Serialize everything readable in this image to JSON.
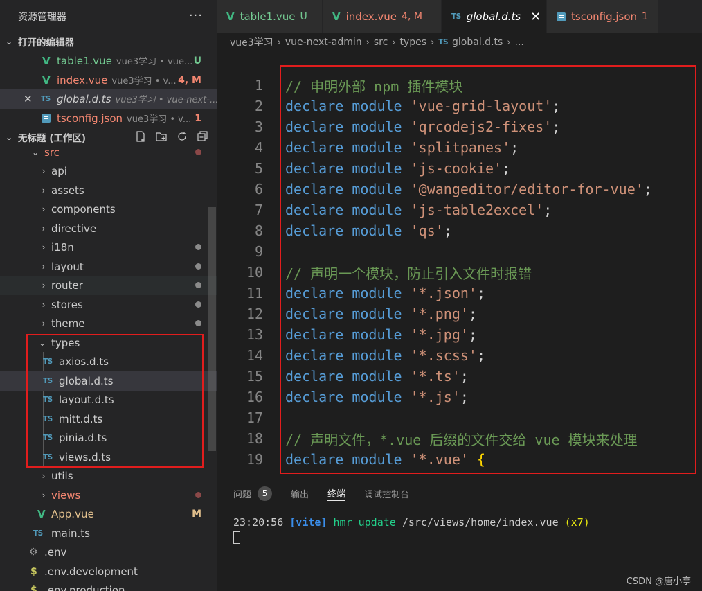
{
  "explorer": {
    "title": "资源管理器",
    "more": "···",
    "open_editors": {
      "title": "打开的编辑器",
      "items": [
        {
          "name": "table1.vue",
          "desc": "vue3学习 • vue...",
          "status": "U"
        },
        {
          "name": "index.vue",
          "desc": "vue3学习 • v...",
          "status": "4, M"
        },
        {
          "name": "global.d.ts",
          "desc": "vue3学习 • vue-next-...",
          "status": ""
        },
        {
          "name": "tsconfig.json",
          "desc": "vue3学习 • v...",
          "status": "1"
        }
      ]
    },
    "workspace": {
      "title": "无标题 (工作区)",
      "items": [
        {
          "name": "src"
        },
        {
          "name": "api"
        },
        {
          "name": "assets"
        },
        {
          "name": "components"
        },
        {
          "name": "directive"
        },
        {
          "name": "i18n"
        },
        {
          "name": "layout"
        },
        {
          "name": "router"
        },
        {
          "name": "stores"
        },
        {
          "name": "theme"
        },
        {
          "name": "types"
        },
        {
          "name": "axios.d.ts"
        },
        {
          "name": "global.d.ts"
        },
        {
          "name": "layout.d.ts"
        },
        {
          "name": "mitt.d.ts"
        },
        {
          "name": "pinia.d.ts"
        },
        {
          "name": "views.d.ts"
        },
        {
          "name": "utils"
        },
        {
          "name": "views"
        },
        {
          "name": "App.vue",
          "status": "M"
        },
        {
          "name": "main.ts"
        },
        {
          "name": ".env"
        },
        {
          "name": ".env.development"
        },
        {
          "name": ".env.production"
        }
      ]
    }
  },
  "tabs": [
    {
      "label": "table1.vue",
      "status": "U",
      "icon": "V"
    },
    {
      "label": "index.vue",
      "status": "4, M",
      "icon": "V"
    },
    {
      "label": "global.d.ts",
      "status": "",
      "icon": "TS",
      "close": "✕"
    },
    {
      "label": "tsconfig.json",
      "status": "1",
      "icon": "{}"
    }
  ],
  "breadcrumb": {
    "items": [
      "vue3学习",
      "vue-next-admin",
      "src",
      "types",
      "TS",
      "global.d.ts",
      "..."
    ],
    "sep": "›"
  },
  "code": {
    "lines": [
      {
        "n": "1",
        "type": "comment",
        "text": "// 申明外部 npm 插件模块"
      },
      {
        "n": "2",
        "type": "decl",
        "kw1": "declare",
        "kw2": "module",
        "str": "'vue-grid-layout'",
        "end": ";"
      },
      {
        "n": "3",
        "type": "decl",
        "kw1": "declare",
        "kw2": "module",
        "str": "'qrcodejs2-fixes'",
        "end": ";"
      },
      {
        "n": "4",
        "type": "decl",
        "kw1": "declare",
        "kw2": "module",
        "str": "'splitpanes'",
        "end": ";"
      },
      {
        "n": "5",
        "type": "decl",
        "kw1": "declare",
        "kw2": "module",
        "str": "'js-cookie'",
        "end": ";"
      },
      {
        "n": "6",
        "type": "decl",
        "kw1": "declare",
        "kw2": "module",
        "str": "'@wangeditor/editor-for-vue'",
        "end": ";"
      },
      {
        "n": "7",
        "type": "decl",
        "kw1": "declare",
        "kw2": "module",
        "str": "'js-table2excel'",
        "end": ";"
      },
      {
        "n": "8",
        "type": "decl",
        "kw1": "declare",
        "kw2": "module",
        "str": "'qs'",
        "end": ";"
      },
      {
        "n": "9",
        "type": "empty",
        "text": ""
      },
      {
        "n": "10",
        "type": "comment",
        "text": "// 声明一个模块，防止引入文件时报错"
      },
      {
        "n": "11",
        "type": "decl",
        "kw1": "declare",
        "kw2": "module",
        "str": "'*.json'",
        "end": ";"
      },
      {
        "n": "12",
        "type": "decl",
        "kw1": "declare",
        "kw2": "module",
        "str": "'*.png'",
        "end": ";"
      },
      {
        "n": "13",
        "type": "decl",
        "kw1": "declare",
        "kw2": "module",
        "str": "'*.jpg'",
        "end": ";"
      },
      {
        "n": "14",
        "type": "decl",
        "kw1": "declare",
        "kw2": "module",
        "str": "'*.scss'",
        "end": ";"
      },
      {
        "n": "15",
        "type": "decl",
        "kw1": "declare",
        "kw2": "module",
        "str": "'*.ts'",
        "end": ";"
      },
      {
        "n": "16",
        "type": "decl",
        "kw1": "declare",
        "kw2": "module",
        "str": "'*.js'",
        "end": ";"
      },
      {
        "n": "17",
        "type": "empty",
        "text": ""
      },
      {
        "n": "18",
        "type": "comment",
        "text": "// 声明文件，*.vue 后缀的文件交给 vue 模块来处理"
      },
      {
        "n": "19",
        "type": "decl",
        "kw1": "declare",
        "kw2": "module",
        "str": "'*.vue'",
        "end": "{"
      }
    ]
  },
  "panel": {
    "tabs": [
      "问题",
      "输出",
      "终端",
      "调试控制台"
    ],
    "problems_count": "5",
    "terminal": {
      "time": "23:20:56",
      "tag": "[vite]",
      "msg": "hmr update",
      "path": "/src/views/home/index.vue",
      "count": "(x7)"
    }
  },
  "watermark": "CSDN @唐小亭",
  "colors": {
    "accent_vue": "#41b883",
    "accent_ts": "#519aba",
    "highlight_box": "#e11d1d",
    "modified": "#e2c08d",
    "untracked": "#73c991",
    "error": "#f48771"
  }
}
